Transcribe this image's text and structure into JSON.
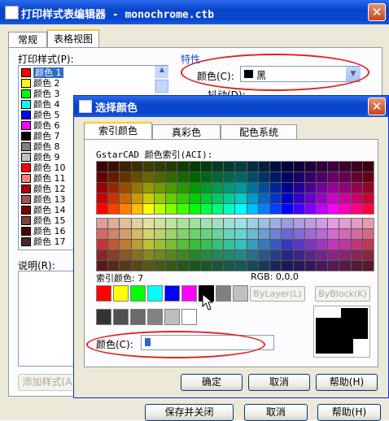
{
  "back": {
    "title": "打印样式表编辑器 - monochrome.ctb",
    "tabs": [
      "常规",
      "表格视图"
    ],
    "print_style_label": "打印样式(P):",
    "list_items": [
      {
        "label": "颜色 1",
        "color": "#ff0000"
      },
      {
        "label": "颜色 2",
        "color": "#ffff00"
      },
      {
        "label": "颜色 3",
        "color": "#00ff00"
      },
      {
        "label": "颜色 4",
        "color": "#00ffff"
      },
      {
        "label": "颜色 5",
        "color": "#0000ff"
      },
      {
        "label": "颜色 6",
        "color": "#ff00ff"
      },
      {
        "label": "颜色 7",
        "color": "#000000"
      },
      {
        "label": "颜色 8",
        "color": "#808080"
      },
      {
        "label": "颜色 9",
        "color": "#c0c0c0"
      },
      {
        "label": "颜色 10",
        "color": "#ff0000"
      },
      {
        "label": "颜色 11",
        "color": "#ff7f7f"
      },
      {
        "label": "颜色 12",
        "color": "#a50000"
      },
      {
        "label": "颜色 13",
        "color": "#a55252"
      },
      {
        "label": "颜色 14",
        "color": "#7f0000"
      },
      {
        "label": "颜色 15",
        "color": "#7f3f3f"
      },
      {
        "label": "颜色 16",
        "color": "#4c0000"
      },
      {
        "label": "颜色 17",
        "color": "#4c2626"
      }
    ],
    "properties_label": "特性",
    "color_label": "颜色(C):",
    "color_value": "黑",
    "cut_label": "抖动(D):",
    "description_label": "说明(R):",
    "add_style_button": "添加样式(A",
    "save_close_button": "保存并关闭",
    "cancel_button": "取消",
    "help_button": "帮助(H)"
  },
  "dialog": {
    "title": "选择颜色",
    "tabs": [
      "索引颜色",
      "真彩色",
      "配色系统"
    ],
    "palette_label": "GstarCAD 颜色索引(ACI):",
    "index_color_label": "索引颜色: 7",
    "rgb_label": "RGB: 0,0,0",
    "bylayer_button": "ByLayer(L)",
    "byblock_button": "ByBlock(K)",
    "color_field_label": "颜色(C):",
    "color_field_value": "",
    "ok_button": "确定",
    "cancel_button": "取消",
    "help_button": "帮助(H)",
    "standard_colors": [
      "#ff0000",
      "#ffff00",
      "#00ff00",
      "#00ffff",
      "#0000ff",
      "#ff00ff",
      "#000000",
      "#808080",
      "#c0c0c0"
    ],
    "gray_colors": [
      "#333333",
      "#505050",
      "#696969",
      "#828282",
      "#bebebe",
      "#ffffff"
    ],
    "selected_index": 7,
    "preview_color": "#000000"
  }
}
